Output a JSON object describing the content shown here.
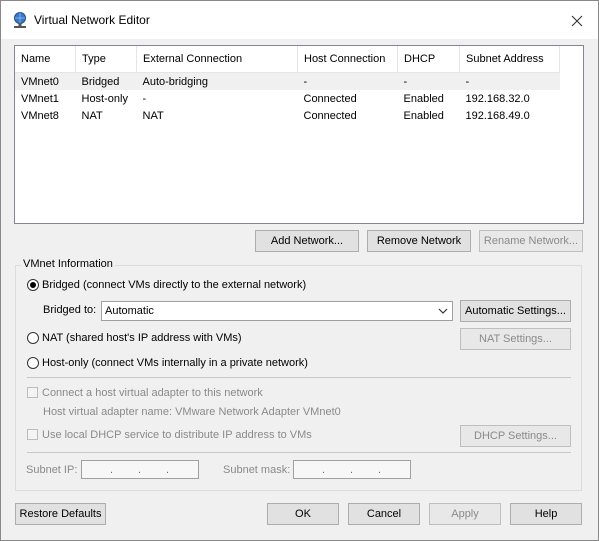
{
  "window": {
    "title": "Virtual Network Editor"
  },
  "table": {
    "headers": [
      "Name",
      "Type",
      "External Connection",
      "Host Connection",
      "DHCP",
      "Subnet Address"
    ],
    "rows": [
      [
        "VMnet0",
        "Bridged",
        "Auto-bridging",
        "-",
        "-",
        "-"
      ],
      [
        "VMnet1",
        "Host-only",
        "-",
        "Connected",
        "Enabled",
        "192.168.32.0"
      ],
      [
        "VMnet8",
        "NAT",
        "NAT",
        "Connected",
        "Enabled",
        "192.168.49.0"
      ]
    ]
  },
  "network_buttons": {
    "add": "Add Network...",
    "remove": "Remove Network",
    "rename": "Rename Network..."
  },
  "vmnet_info": {
    "group_label": "VMnet Information",
    "bridged_label": "Bridged (connect VMs directly to the external network)",
    "bridged_to_label": "Bridged to:",
    "bridged_to_value": "Automatic",
    "automatic_settings": "Automatic Settings...",
    "nat_label": "NAT (shared host's IP address with VMs)",
    "nat_settings": "NAT Settings...",
    "hostonly_label": "Host-only (connect VMs internally in a private network)",
    "connect_adapter_label": "Connect a host virtual adapter to this network",
    "adapter_name_text": "Host virtual adapter name: VMware Network Adapter VMnet0",
    "dhcp_label": "Use local DHCP service to distribute IP address to VMs",
    "dhcp_settings": "DHCP Settings...",
    "subnet_ip_label": "Subnet IP:",
    "subnet_mask_label": "Subnet mask:",
    "ip_dot": "."
  },
  "footer": {
    "restore": "Restore Defaults",
    "ok": "OK",
    "cancel": "Cancel",
    "apply": "Apply",
    "help": "Help"
  },
  "icons": {
    "title": "network-globe-icon",
    "close": "close-icon",
    "dropdown": "chevron-down-icon"
  },
  "colors": {
    "selected_row": "#f0f0f0",
    "focus_border": "#0078d7"
  }
}
